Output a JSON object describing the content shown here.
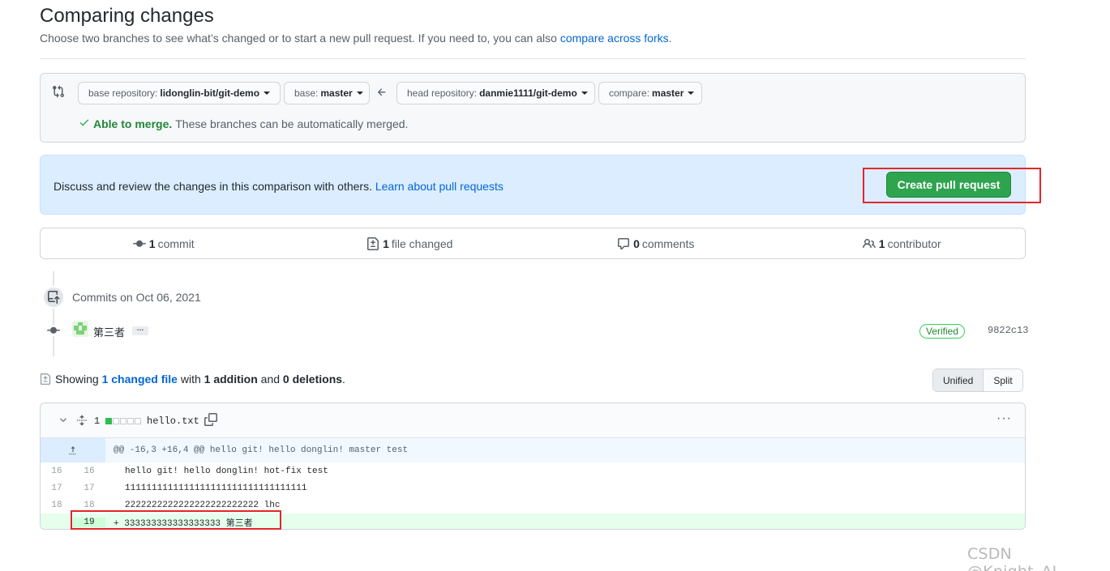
{
  "header": {
    "title": "Comparing changes",
    "subtitle_prefix": "Choose two branches to see what’s changed or to start a new pull request. If you need to, you can also ",
    "subtitle_link": "compare across forks",
    "subtitle_suffix": "."
  },
  "range": {
    "base_repo_label": "base repository:",
    "base_repo_value": "lidonglin-bit/git-demo",
    "base_label": "base:",
    "base_value": "master",
    "head_repo_label": "head repository:",
    "head_repo_value": "danmie1111/git-demo",
    "compare_label": "compare:",
    "compare_value": "master",
    "merge_ok": "Able to merge.",
    "merge_text": "These branches can be automatically merged."
  },
  "blankslate": {
    "message": "Discuss and review the changes in this comparison with others. ",
    "link": "Learn about pull requests",
    "create_button": "Create pull request"
  },
  "summary": {
    "commits_count": "1",
    "commits_label": "commit",
    "files_count": "1",
    "files_label": "file changed",
    "comments_count": "0",
    "comments_label": "comments",
    "contributors_count": "1",
    "contributors_label": "contributor"
  },
  "commits": {
    "date_heading": "Commits on Oct 06, 2021",
    "items": [
      {
        "message": "第三者",
        "ellipsis": "…",
        "verified": "Verified",
        "sha": "9822c13"
      }
    ]
  },
  "toc": {
    "showing": "Showing ",
    "changed_link": "1 changed file",
    "with": " with ",
    "additions": "1 addition",
    "and": " and ",
    "deletions": "0 deletions",
    "period": ".",
    "unified": "Unified",
    "split": "Split"
  },
  "file": {
    "changes": "1",
    "diffstat": [
      1,
      0,
      0,
      0,
      0
    ],
    "name": "hello.txt",
    "more": "···",
    "hunk_header": "@@ -16,3 +16,4 @@ hello git! hello donglin! master test",
    "lines": [
      {
        "type": "context",
        "old": "16",
        "new": "16",
        "text": "hello git! hello donglin! hot-fix test"
      },
      {
        "type": "context",
        "old": "17",
        "new": "17",
        "text": "1111111111111111111111111111111111"
      },
      {
        "type": "context",
        "old": "18",
        "new": "18",
        "text": "2222222222222222222222222 lhc"
      },
      {
        "type": "add",
        "old": "",
        "new": "19",
        "marker": "+",
        "text": "333333333333333333 第三者"
      }
    ]
  },
  "watermark": "CSDN @Knight_AL",
  "colors": {
    "link": "#0366d6",
    "create_button": "#2ea44f",
    "highlight_box": "#e3262c",
    "added_line": "#e6ffed",
    "blue_banner": "#dbedff"
  }
}
